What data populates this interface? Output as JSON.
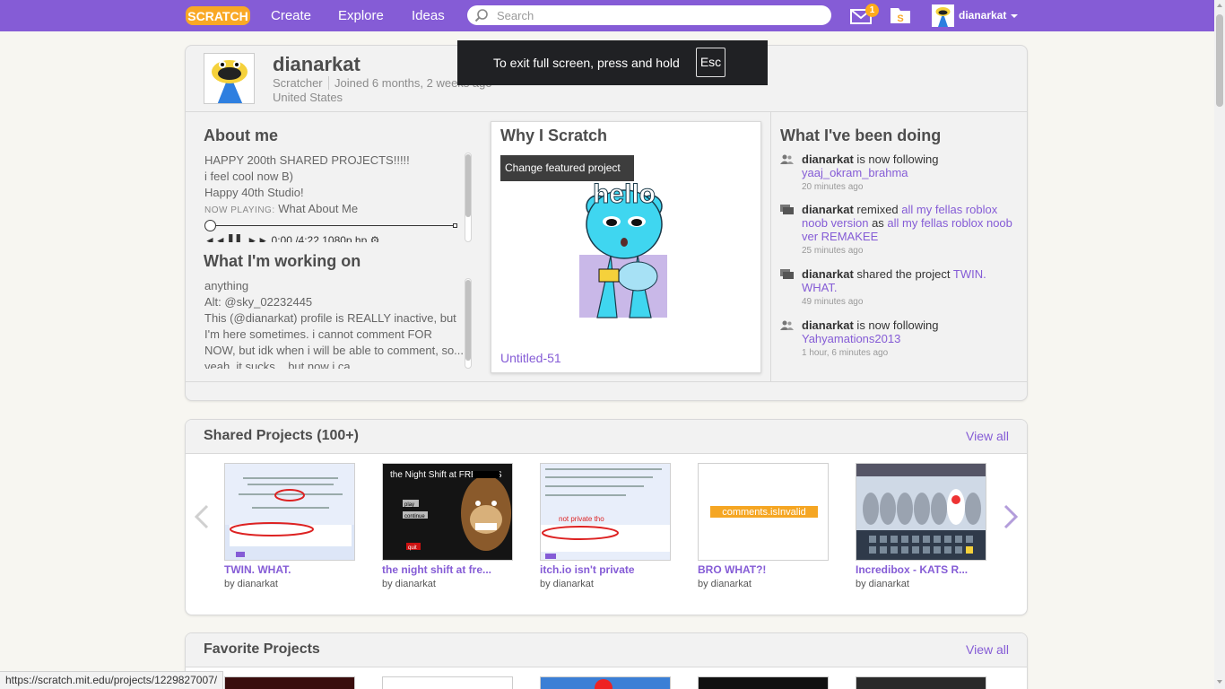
{
  "nav": {
    "logo": "SCRATCH",
    "links": [
      "Create",
      "Explore",
      "Ideas"
    ],
    "search_placeholder": "Search",
    "message_count": "1",
    "username": "dianarkat",
    "colors": {
      "bar": "#855cd6",
      "badge": "#ffab1a"
    }
  },
  "fullscreen_notice": {
    "text": "To exit full screen, press and hold",
    "key": "Esc"
  },
  "profile": {
    "username": "dianarkat",
    "role": "Scratcher",
    "joined": "Joined 6 months, 2 weeks ago",
    "country": "United States",
    "about_title": "About me",
    "about_lines": [
      "HAPPY 200th SHARED PROJECTS!!!!!",
      "i feel cool now B)",
      "Happy 40th Studio!"
    ],
    "now_playing_label": "NOW PLAYING:",
    "now_playing_song": "What About Me",
    "player_controls": "◄◄ ▌▌ ►► 0:00 /4:22   1080p hp ⚙",
    "working_title": "What I'm working on",
    "working_lines": [
      "anything",
      "Alt: @sky_02232445",
      "This (@dianarkat) profile is REALLY inactive, but",
      "I'm here sometimes. i cannot comment FOR",
      "NOW, but idk when i will be able to comment, so...",
      "yeah, it sucks... but now i ca"
    ],
    "why_title": "Why I Scratch",
    "featured_tooltip": "Change featured project",
    "featured_project": "Untitled-51",
    "featured_image_text": "hello"
  },
  "activity": {
    "title": "What I've been doing",
    "items": [
      {
        "user": "dianarkat",
        "action": " is now following ",
        "link": "yaaj_okram_brahma",
        "extra_action": "",
        "extra_link": "",
        "time": "20 minutes ago",
        "icon": "follow-icon"
      },
      {
        "user": "dianarkat",
        "action": " remixed ",
        "link": "all my fellas roblox noob version",
        "extra_action": " as ",
        "extra_link": "all my fellas roblox noob ver REMAKEE",
        "time": "25 minutes ago",
        "icon": "project-icon"
      },
      {
        "user": "dianarkat",
        "action": " shared the project ",
        "link": "TWIN. WHAT.",
        "extra_action": "",
        "extra_link": "",
        "time": "49 minutes ago",
        "icon": "project-icon"
      },
      {
        "user": "dianarkat",
        "action": " is now following ",
        "link": "Yahyamations2013",
        "extra_action": "",
        "extra_link": "",
        "time": "1 hour, 6 minutes ago",
        "icon": "follow-icon"
      }
    ]
  },
  "shared": {
    "title": "Shared Projects (100+)",
    "view_all": "View all",
    "projects": [
      {
        "title": "TWIN. WHAT.",
        "by": "by dianarkat"
      },
      {
        "title": "the night shift at fre...",
        "by": "by dianarkat",
        "thumb_text": "the Night Shift at FREDDYS",
        "thumb_buttons": [
          "play",
          "continue",
          "quit"
        ]
      },
      {
        "title": "itch.io isn't private",
        "by": "by dianarkat",
        "thumb_text": "not private tho"
      },
      {
        "title": "BRO WHAT?!",
        "by": "by dianarkat",
        "thumb_text": "comments.isInvalid"
      },
      {
        "title": "Incredibox - KATS R...",
        "by": "by dianarkat"
      }
    ]
  },
  "favorites": {
    "title": "Favorite Projects",
    "view_all": "View all"
  },
  "status_url": "https://scratch.mit.edu/projects/1229827007/"
}
